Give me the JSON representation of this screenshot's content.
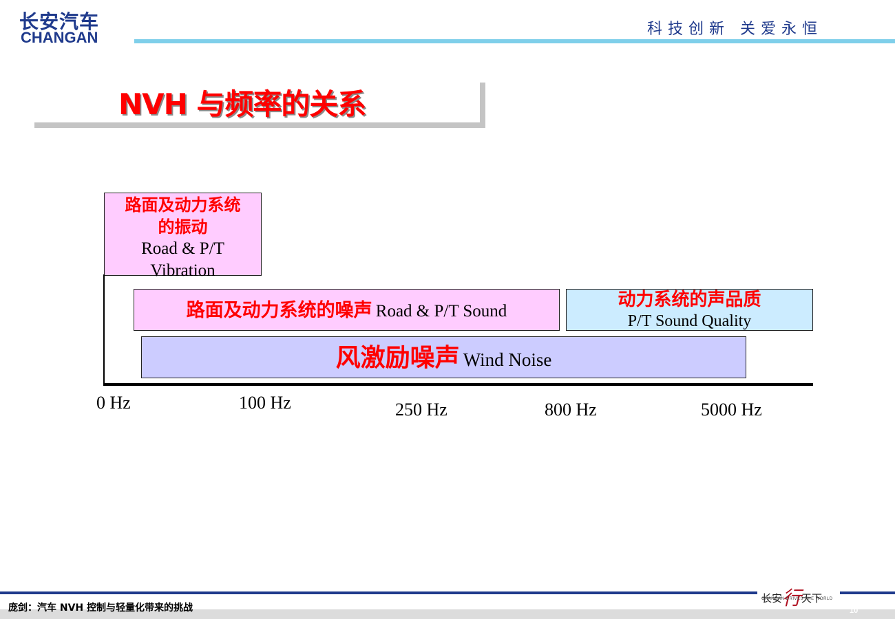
{
  "header": {
    "logo_cn": "长安汽车",
    "logo_en": "CHANGAN",
    "slogan": "科技创新 关爱永恒",
    "accent_color": "#7fcfea",
    "brand_color": "#1f3a8c"
  },
  "title": "NVH 与频率的关系",
  "diagram": {
    "vibration": {
      "cn": "路面及动力系统的振动",
      "cn_line1": "路面及动力系统",
      "cn_line2": "的振动",
      "en_line1": "Road & P/T",
      "en_line2": "Vibration",
      "color": "#ffccff"
    },
    "road_sound": {
      "cn": "路面及动力系统的噪声",
      "en": "Road & P/T Sound",
      "color": "#ffccff"
    },
    "sound_quality": {
      "cn": "动力系统的声品质",
      "en": "P/T Sound Quality",
      "color": "#ccecff"
    },
    "wind_noise": {
      "cn": "风激励噪声",
      "en": "Wind Noise",
      "color": "#ccccff"
    },
    "axis_ticks": [
      "0 Hz",
      "100 Hz",
      "250 Hz",
      "800 Hz",
      "5000 Hz"
    ]
  },
  "footer": {
    "text": "庞剑：汽车 NVH 控制与轻量化带来的挑战",
    "logo_cn_left": "长安",
    "logo_cn_char": "行",
    "logo_cn_right": "天下",
    "logo_en": "CHANGAN DRIVES THE WORLD",
    "page": "10"
  }
}
